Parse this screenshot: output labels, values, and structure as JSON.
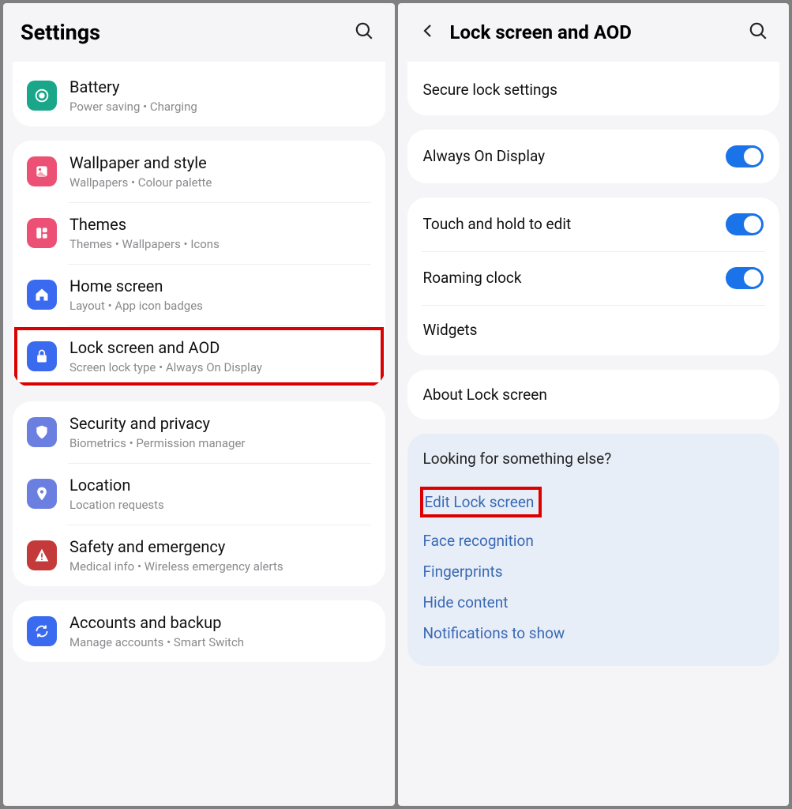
{
  "left": {
    "title": "Settings",
    "groups": [
      {
        "items": [
          {
            "key": "battery",
            "icon": "battery-icon",
            "color": "ic-teal",
            "title": "Battery",
            "sub": "Power saving  •  Charging"
          }
        ],
        "cutTop": true
      },
      {
        "items": [
          {
            "key": "wallpaper",
            "icon": "wallpaper-icon",
            "color": "ic-pink",
            "title": "Wallpaper and style",
            "sub": "Wallpapers  •  Colour palette"
          },
          {
            "key": "themes",
            "icon": "themes-icon",
            "color": "ic-pink2",
            "title": "Themes",
            "sub": "Themes  •  Wallpapers  •  Icons"
          },
          {
            "key": "home",
            "icon": "home-icon",
            "color": "ic-blue",
            "title": "Home screen",
            "sub": "Layout  •  App icon badges"
          },
          {
            "key": "lockscreen",
            "icon": "lock-icon",
            "color": "ic-blue",
            "title": "Lock screen and AOD",
            "sub": "Screen lock type  •  Always On Display",
            "highlight": true
          }
        ]
      },
      {
        "items": [
          {
            "key": "security",
            "icon": "shield-icon",
            "color": "ic-bluel",
            "title": "Security and privacy",
            "sub": "Biometrics  •  Permission manager"
          },
          {
            "key": "location",
            "icon": "location-icon",
            "color": "ic-bluel",
            "title": "Location",
            "sub": "Location requests"
          },
          {
            "key": "safety",
            "icon": "warning-icon",
            "color": "ic-red",
            "title": "Safety and emergency",
            "sub": "Medical info  •  Wireless emergency alerts"
          }
        ]
      },
      {
        "items": [
          {
            "key": "accounts",
            "icon": "sync-icon",
            "color": "ic-blue",
            "title": "Accounts and backup",
            "sub": "Manage accounts  •  Smart Switch"
          }
        ]
      }
    ]
  },
  "right": {
    "title": "Lock screen and AOD",
    "rows": [
      {
        "key": "secure",
        "title": "Secure lock settings"
      },
      {
        "key": "aod",
        "title": "Always On Display",
        "toggle": true,
        "sep": true
      },
      {
        "key": "touch",
        "title": "Touch and hold to edit",
        "toggle": true,
        "sep": true
      },
      {
        "key": "roaming",
        "title": "Roaming clock",
        "toggle": true
      },
      {
        "key": "widgets",
        "title": "Widgets"
      },
      {
        "key": "about",
        "title": "About Lock screen",
        "sep": true
      }
    ],
    "suggest": {
      "heading": "Looking for something else?",
      "links": [
        {
          "key": "edit",
          "label": "Edit Lock screen",
          "highlight": true
        },
        {
          "key": "face",
          "label": "Face recognition"
        },
        {
          "key": "finger",
          "label": "Fingerprints"
        },
        {
          "key": "hide",
          "label": "Hide content"
        },
        {
          "key": "notif",
          "label": "Notifications to show"
        }
      ]
    }
  }
}
